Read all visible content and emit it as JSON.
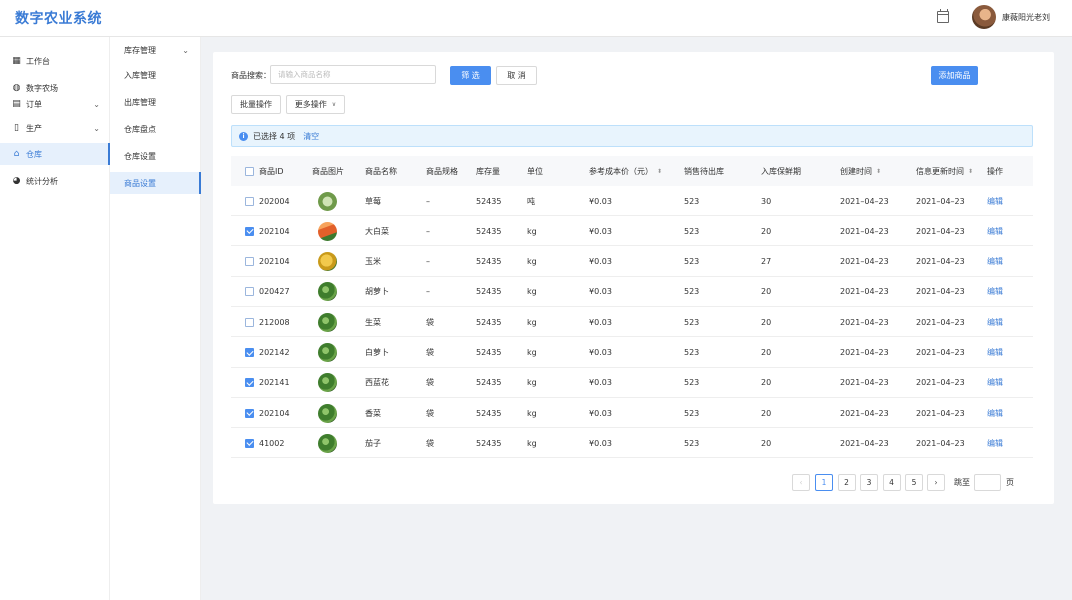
{
  "header": {
    "title": "数字农业系统",
    "calendar_icon": "calendar-icon",
    "username": "康薇阳光老刘"
  },
  "sidebar": {
    "items": [
      {
        "label": "工作台",
        "icon": "dashboard-icon",
        "glyph": "▦"
      },
      {
        "label": "数字农场",
        "icon": "globe-icon",
        "glyph": "◍"
      },
      {
        "label": "订单",
        "icon": "document-icon",
        "glyph": "▤",
        "has_children": true
      },
      {
        "label": "生产",
        "icon": "bookmark-icon",
        "glyph": "▯",
        "has_children": true
      },
      {
        "label": "仓库",
        "icon": "home-icon",
        "glyph": "⌂",
        "active": true
      },
      {
        "label": "统计分析",
        "icon": "pie-chart-icon",
        "glyph": "◕"
      }
    ]
  },
  "submenu": {
    "items": [
      {
        "label": "库存管理",
        "has_children": true
      },
      {
        "label": "入库管理"
      },
      {
        "label": "出库管理"
      },
      {
        "label": "仓库盘点"
      },
      {
        "label": "仓库设置"
      },
      {
        "label": "商品设置",
        "active": true
      }
    ]
  },
  "toolbar": {
    "search_label": "商品搜索：",
    "search_placeholder": "请输入商品名称",
    "search_value": "",
    "filter_label": "筛 选",
    "cancel_label": "取 消",
    "add_label": "添加商品",
    "batch_label": "批量操作",
    "more_label": "更多操作",
    "more_chevron": "∨"
  },
  "alert": {
    "text": "已选择 4 项",
    "clear_label": "清空",
    "icon": "info-icon",
    "icon_glyph": "i"
  },
  "table": {
    "columns": [
      "商品ID",
      "商品图片",
      "商品名称",
      "商品规格",
      "库存量",
      "单位",
      "参考成本价（元）",
      "销售待出库",
      "入库保鲜期",
      "创建时间",
      "信息更新时间",
      "操作"
    ],
    "sortable": [
      6,
      9,
      10
    ],
    "sort_glyph": "⬍",
    "rows": [
      {
        "checked": false,
        "id": "202004",
        "img": "lettuce",
        "name": "草莓",
        "spec": "–",
        "stock": "52435",
        "unit": "吨",
        "cost": "¥0.03",
        "pending": "523",
        "fresh": "30",
        "created": "2021–04–23",
        "updated": "2021–04–23",
        "action": "编辑"
      },
      {
        "checked": true,
        "id": "202104",
        "img": "carrot",
        "name": "大白菜",
        "spec": "–",
        "stock": "52435",
        "unit": "kg",
        "cost": "¥0.03",
        "pending": "523",
        "fresh": "20",
        "created": "2021–04–23",
        "updated": "2021–04–23",
        "action": "编辑"
      },
      {
        "checked": false,
        "id": "202104",
        "img": "corn",
        "name": "玉米",
        "spec": "–",
        "stock": "52435",
        "unit": "kg",
        "cost": "¥0.03",
        "pending": "523",
        "fresh": "27",
        "created": "2021–04–23",
        "updated": "2021–04–23",
        "action": "编辑"
      },
      {
        "checked": false,
        "id": "020427",
        "img": "broccoli",
        "name": "胡萝卜",
        "spec": "–",
        "stock": "52435",
        "unit": "kg",
        "cost": "¥0.03",
        "pending": "523",
        "fresh": "20",
        "created": "2021–04–23",
        "updated": "2021–04–23",
        "action": "编辑"
      },
      {
        "checked": false,
        "id": "212008",
        "img": "broccoli",
        "name": "生菜",
        "spec": "袋",
        "stock": "52435",
        "unit": "kg",
        "cost": "¥0.03",
        "pending": "523",
        "fresh": "20",
        "created": "2021–04–23",
        "updated": "2021–04–23",
        "action": "编辑"
      },
      {
        "checked": true,
        "id": "202142",
        "img": "broccoli",
        "name": "白萝卜",
        "spec": "袋",
        "stock": "52435",
        "unit": "kg",
        "cost": "¥0.03",
        "pending": "523",
        "fresh": "20",
        "created": "2021–04–23",
        "updated": "2021–04–23",
        "action": "编辑"
      },
      {
        "checked": true,
        "id": "202141",
        "img": "broccoli",
        "name": "西蓝花",
        "spec": "袋",
        "stock": "52435",
        "unit": "kg",
        "cost": "¥0.03",
        "pending": "523",
        "fresh": "20",
        "created": "2021–04–23",
        "updated": "2021–04–23",
        "action": "编辑"
      },
      {
        "checked": true,
        "id": "202104",
        "img": "broccoli",
        "name": "香菜",
        "spec": "袋",
        "stock": "52435",
        "unit": "kg",
        "cost": "¥0.03",
        "pending": "523",
        "fresh": "20",
        "created": "2021–04–23",
        "updated": "2021–04–23",
        "action": "编辑"
      },
      {
        "checked": true,
        "id": "41002",
        "img": "broccoli",
        "name": "茄子",
        "spec": "袋",
        "stock": "52435",
        "unit": "kg",
        "cost": "¥0.03",
        "pending": "523",
        "fresh": "20",
        "created": "2021–04–23",
        "updated": "2021–04–23",
        "action": "编辑"
      }
    ]
  },
  "pagination": {
    "prev": "‹",
    "next": "›",
    "pages": [
      "1",
      "2",
      "3",
      "4",
      "5"
    ],
    "current": "1",
    "jump_label": "跳至",
    "page_suffix": "页"
  },
  "colors": {
    "accent": "#4a8ef0",
    "brand": "#3a7bd5"
  }
}
